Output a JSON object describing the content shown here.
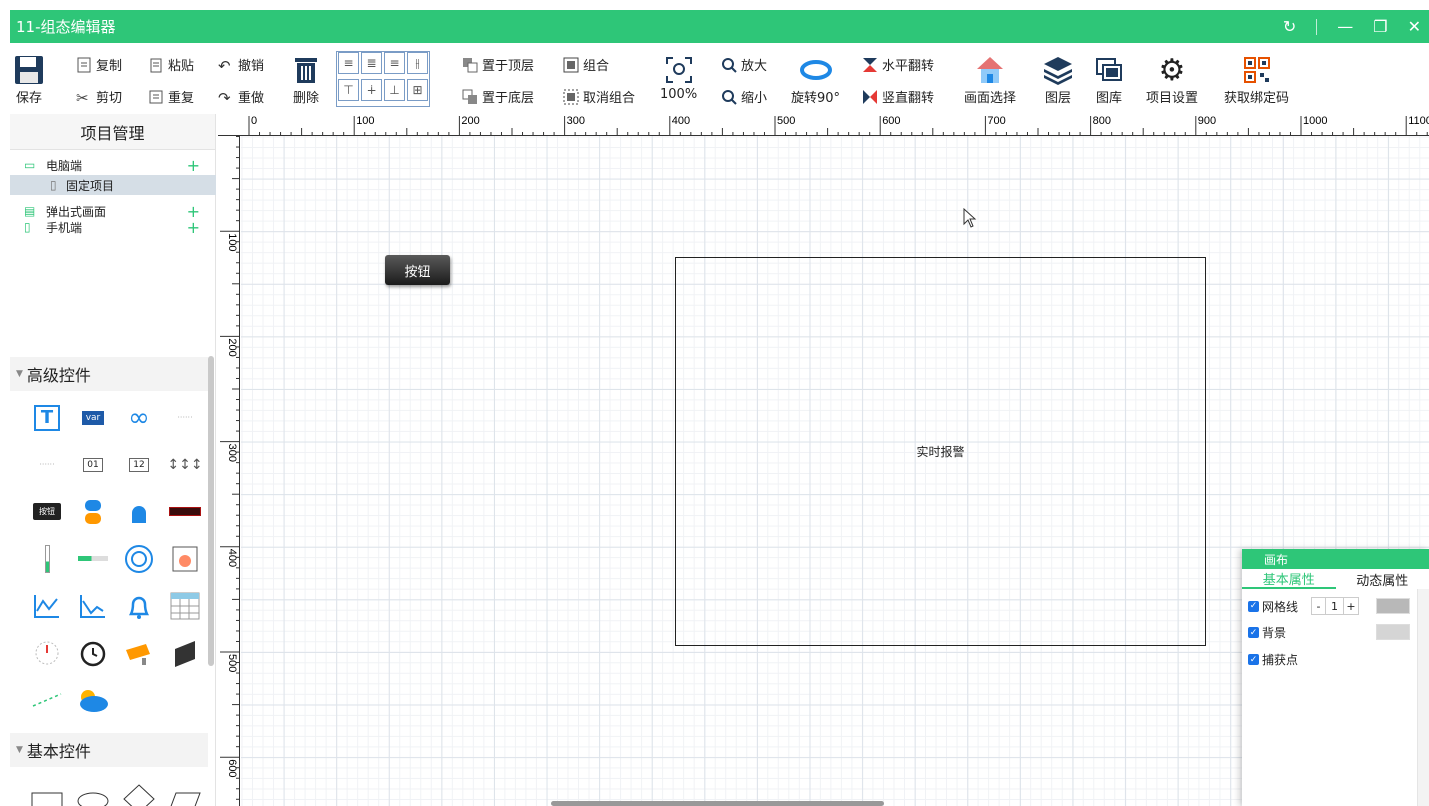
{
  "window": {
    "title": "11-组态编辑器",
    "controls": [
      "↻",
      "—",
      "❐",
      "✕"
    ]
  },
  "toolbar": {
    "save": "保存",
    "copy": "复制",
    "cut": "剪切",
    "paste": "粘贴",
    "repeat": "重复",
    "undo": "撤销",
    "redo": "重做",
    "delete": "删除",
    "bring_top": "置于顶层",
    "send_bottom": "置于底层",
    "group": "组合",
    "ungroup": "取消组合",
    "zoom_reset": "100%",
    "zoom_in": "放大",
    "zoom_out": "缩小",
    "rotate": "旋转90°",
    "flip_h": "水平翻转",
    "flip_v": "竖直翻转",
    "screen_select": "画面选择",
    "layers": "图层",
    "gallery": "图库",
    "project_settings": "项目设置",
    "bind_code": "获取绑定码"
  },
  "left": {
    "header": "项目管理",
    "tree": [
      {
        "label": "电脑端"
      },
      {
        "label": "固定项目"
      },
      {
        "label": "弹出式画面"
      },
      {
        "label": "手机端"
      }
    ],
    "section_advanced": "高级控件",
    "section_basic": "基本控件",
    "widget_labels": {
      "button": "按钮",
      "num1": "01",
      "num2": "12",
      "var": "var"
    }
  },
  "ruler": {
    "h_labels": [
      "0",
      "100",
      "200",
      "300",
      "400",
      "500",
      "600",
      "700",
      "800",
      "900",
      "1000",
      "1100"
    ],
    "v_labels": [
      "100",
      "200",
      "300",
      "400",
      "500",
      "600"
    ]
  },
  "canvas": {
    "button_label": "按钮",
    "alarm_label": "实时报警"
  },
  "props": {
    "title": "画布",
    "tabs": [
      "基本属性",
      "动态属性"
    ],
    "grid_label": "网格线",
    "grid_value": "1",
    "bg_label": "背景",
    "snap_label": "捕获点",
    "grid_color": "#b8b8b8",
    "bg_color": "#d5d5d5"
  },
  "colors": {
    "accent": "#2ec678"
  }
}
